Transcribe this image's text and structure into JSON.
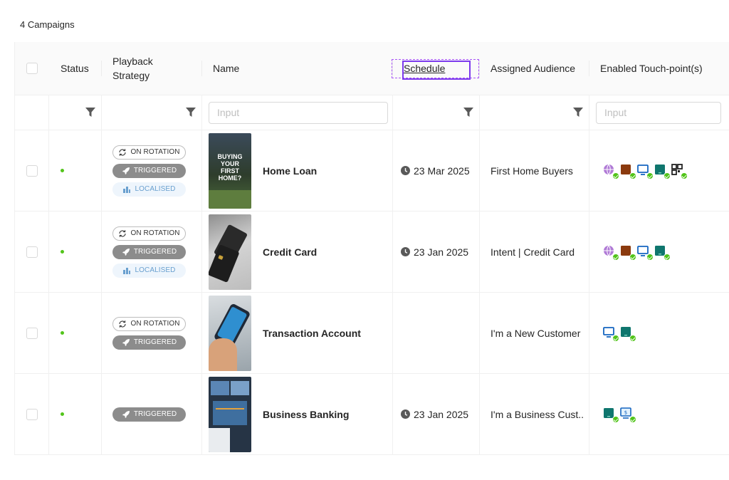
{
  "campaign_count_label": "4 Campaigns",
  "columns": {
    "status": "Status",
    "playback": "Playback Strategy",
    "name": "Name",
    "schedule": "Schedule",
    "audience": "Assigned Audience",
    "touchpoints": "Enabled Touch-point(s)"
  },
  "filters": {
    "name_placeholder": "Input",
    "touch_placeholder": "Input"
  },
  "tags": {
    "rotation": "ON ROTATION",
    "triggered": "TRIGGERED",
    "localised": "LOCALISED"
  },
  "colors": {
    "status_dot": "#52c41a",
    "selection_outline": "#7c3aed",
    "check_badge": "#52c41a"
  },
  "rows": [
    {
      "name": "Home Loan",
      "schedule": "23 Mar 2025",
      "audience": "First Home Buyers",
      "thumb_text": [
        "BUYING",
        "YOUR",
        "FIRST",
        "HOME?"
      ],
      "touchpoint_icons": [
        "globe-icon",
        "kiosk-icon",
        "monitor-icon",
        "tablet-icon",
        "qr-code-icon"
      ]
    },
    {
      "name": "Credit Card",
      "schedule": "23 Jan 2025",
      "audience": "Intent | Credit Card",
      "touchpoint_icons": [
        "globe-icon",
        "kiosk-icon",
        "monitor-icon",
        "tablet-icon"
      ]
    },
    {
      "name": "Transaction Account",
      "schedule": "",
      "audience": "I'm a New Customer",
      "touchpoint_icons": [
        "monitor-icon",
        "tablet-icon"
      ]
    },
    {
      "name": "Business Banking",
      "schedule": "23 Jan 2025",
      "audience": "I'm a Business Cust..",
      "touchpoint_icons": [
        "tablet-icon",
        "atm-screen-icon"
      ]
    }
  ]
}
